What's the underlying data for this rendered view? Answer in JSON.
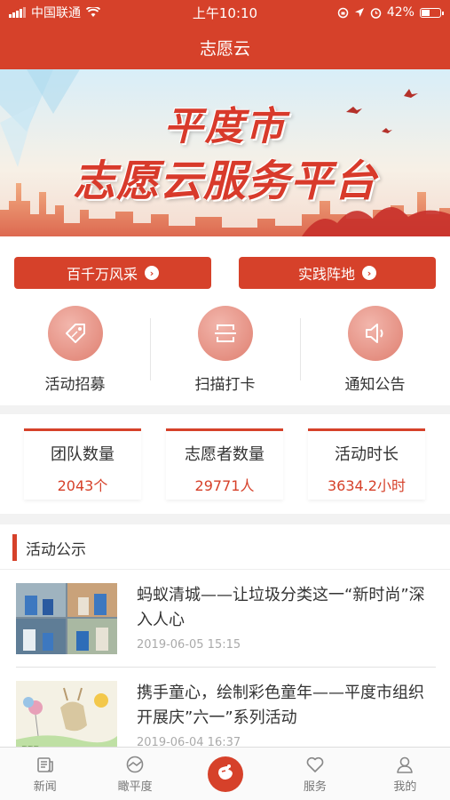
{
  "status_bar": {
    "carrier": "中国联通",
    "time": "上午10:10",
    "battery": "42%"
  },
  "header": {
    "title": "志愿云"
  },
  "banner": {
    "line1": "平度市",
    "line2": "志愿云服务平台"
  },
  "quick_buttons": [
    {
      "label": "百千万风采"
    },
    {
      "label": "实践阵地"
    }
  ],
  "features": [
    {
      "label": "活动招募",
      "icon": "tag-icon"
    },
    {
      "label": "扫描打卡",
      "icon": "scan-icon"
    },
    {
      "label": "通知公告",
      "icon": "speaker-icon"
    }
  ],
  "stats": [
    {
      "label": "团队数量",
      "value": "2043个"
    },
    {
      "label": "志愿者数量",
      "value": "29771人"
    },
    {
      "label": "活动时长",
      "value": "3634.2小时"
    }
  ],
  "news": {
    "section_title": "活动公示",
    "items": [
      {
        "title": "蚂蚁清城——让垃圾分类这一“新时尚”深入人心",
        "date": "2019-06-05 15:15"
      },
      {
        "title": " 携手童心，绘制彩色童年——平度市组织开展庆”六一”系列活动",
        "date": "2019-06-04 16:37"
      }
    ]
  },
  "tabbar": {
    "tabs": [
      {
        "label": "新闻",
        "icon": "news-icon"
      },
      {
        "label": "瞰平度",
        "icon": "explore-icon"
      },
      {
        "label": "",
        "icon": "volunteer-hand-icon"
      },
      {
        "label": "服务",
        "icon": "heart-icon"
      },
      {
        "label": "我的",
        "icon": "user-icon"
      }
    ]
  },
  "colors": {
    "brand": "#d6412a",
    "background": "#f2f2f2"
  }
}
